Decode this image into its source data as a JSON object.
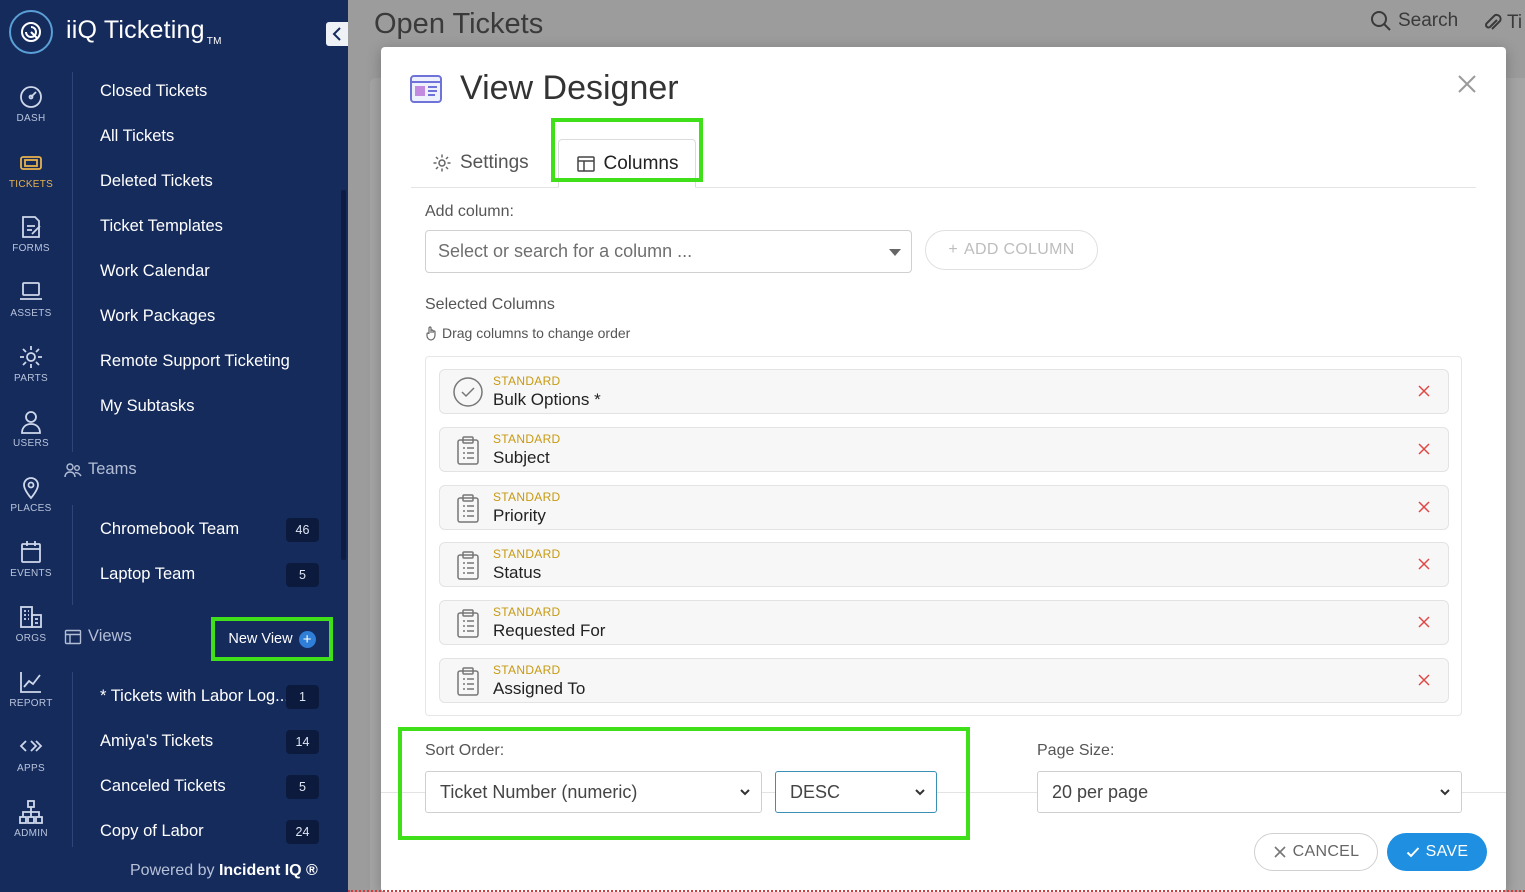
{
  "app": {
    "brand": "iiQ Ticketing",
    "tm": "TM",
    "powered_prefix": "Powered by ",
    "powered_brand": "Incident IQ ®"
  },
  "rail": [
    {
      "label": "DASH",
      "icon": "dashboard-icon"
    },
    {
      "label": "TICKETS",
      "icon": "ticket-icon",
      "active": true
    },
    {
      "label": "FORMS",
      "icon": "forms-icon"
    },
    {
      "label": "ASSETS",
      "icon": "laptop-icon"
    },
    {
      "label": "PARTS",
      "icon": "gear-icon"
    },
    {
      "label": "USERS",
      "icon": "user-icon"
    },
    {
      "label": "PLACES",
      "icon": "map-pin-icon"
    },
    {
      "label": "EVENTS",
      "icon": "calendar-icon"
    },
    {
      "label": "ORGS",
      "icon": "building-icon"
    },
    {
      "label": "REPORT",
      "icon": "chart-icon"
    },
    {
      "label": "APPS",
      "icon": "apps-icon"
    },
    {
      "label": "ADMIN",
      "icon": "sitemap-icon"
    }
  ],
  "sidebar": {
    "items": [
      "Closed Tickets",
      "All Tickets",
      "Deleted Tickets",
      "Ticket Templates",
      "Work Calendar",
      "Work Packages",
      "Remote Support Ticketing",
      "My Subtasks"
    ],
    "teams_heading": "Teams",
    "teams": [
      {
        "label": "Chromebook Team",
        "count": "46"
      },
      {
        "label": "Laptop Team",
        "count": "5"
      }
    ],
    "views_heading": "Views",
    "new_view": "New View",
    "views": [
      {
        "label": "* Tickets with Labor Log...",
        "count": "1"
      },
      {
        "label": "Amiya's Tickets",
        "count": "14"
      },
      {
        "label": "Canceled Tickets",
        "count": "5"
      },
      {
        "label": "Copy of Labor",
        "count": "24"
      }
    ]
  },
  "header": {
    "page_title": "Open Tickets",
    "search_label": "Search",
    "attach_label": "Ti"
  },
  "modal": {
    "title": "View Designer",
    "tabs": {
      "settings": "Settings",
      "columns": "Columns"
    },
    "add_column_label": "Add column:",
    "column_select_placeholder": "Select or search for a column ...",
    "add_column_button": "ADD COLUMN",
    "selected_columns_label": "Selected Columns",
    "drag_hint": "Drag columns to change order",
    "columns": [
      {
        "type": "STANDARD",
        "name": "Bulk Options *",
        "icon": "check-circle-icon"
      },
      {
        "type": "STANDARD",
        "name": "Subject",
        "icon": "clipboard-icon"
      },
      {
        "type": "STANDARD",
        "name": "Priority",
        "icon": "clipboard-icon"
      },
      {
        "type": "STANDARD",
        "name": "Status",
        "icon": "clipboard-icon"
      },
      {
        "type": "STANDARD",
        "name": "Requested For",
        "icon": "clipboard-icon"
      },
      {
        "type": "STANDARD",
        "name": "Assigned To",
        "icon": "clipboard-icon"
      }
    ],
    "sort_order_label": "Sort Order:",
    "sort_field": "Ticket Number (numeric)",
    "sort_direction": "DESC",
    "page_size_label": "Page Size:",
    "page_size": "20 per page",
    "cancel": "CANCEL",
    "save": "SAVE"
  },
  "colors": {
    "navy": "#152b5c",
    "highlight": "#3fe01a",
    "accent_blue": "#1e8fe1",
    "standard_gold": "#c79a11",
    "remove_red": "#e04848"
  }
}
